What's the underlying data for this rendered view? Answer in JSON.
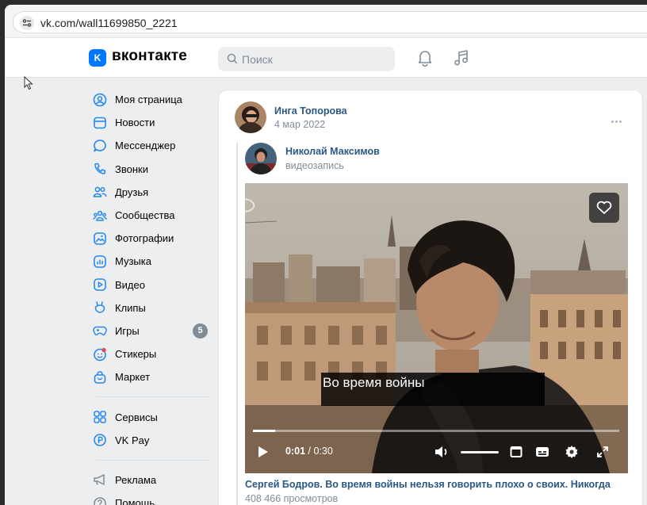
{
  "browser": {
    "url": "vk.com/wall11699850_2221"
  },
  "header": {
    "logo_letter": "K",
    "brand": "вконтакте",
    "search_placeholder": "Поиск",
    "icons": [
      "notifications-bell-icon",
      "music-note-icon"
    ]
  },
  "sidebar": {
    "items": [
      {
        "label": "Моя страница",
        "icon": "user-circle-icon"
      },
      {
        "label": "Новости",
        "icon": "news-icon"
      },
      {
        "label": "Мессенджер",
        "icon": "message-bubble-icon"
      },
      {
        "label": "Звонки",
        "icon": "phone-icon"
      },
      {
        "label": "Друзья",
        "icon": "friends-icon"
      },
      {
        "label": "Сообщества",
        "icon": "communities-icon"
      },
      {
        "label": "Фотографии",
        "icon": "photo-icon"
      },
      {
        "label": "Музыка",
        "icon": "music-icon"
      },
      {
        "label": "Видео",
        "icon": "video-icon"
      },
      {
        "label": "Клипы",
        "icon": "clips-icon"
      },
      {
        "label": "Игры",
        "icon": "gamepad-icon",
        "badge": "5"
      },
      {
        "label": "Стикеры",
        "icon": "sticker-icon"
      },
      {
        "label": "Маркет",
        "icon": "bag-icon"
      }
    ],
    "services": [
      {
        "label": "Сервисы",
        "icon": "services-icon"
      },
      {
        "label": "VK Pay",
        "icon": "vkpay-icon"
      }
    ],
    "footer": [
      {
        "label": "Реклама",
        "icon": "megaphone-icon"
      },
      {
        "label": "Помощь",
        "icon": "help-icon"
      }
    ]
  },
  "post": {
    "author": "Инга Топорова",
    "date": "4 мар 2022",
    "repost": {
      "author": "Николай Максимов",
      "subtitle": "видеозапись"
    },
    "video": {
      "subtitle_text": "Во время войны",
      "time_current": "0:01",
      "time_separator": " / ",
      "time_total": "0:30",
      "progress": 0.06,
      "volume": 1.0
    },
    "caption": "Сергей Бодров. Во время войны нельзя говорить плохо о своих. Никогда",
    "views": "408 466 просмотров"
  },
  "colors": {
    "accent": "#0077ff",
    "link": "#2a5885",
    "muted": "#818c99",
    "background": "#edeef0"
  }
}
